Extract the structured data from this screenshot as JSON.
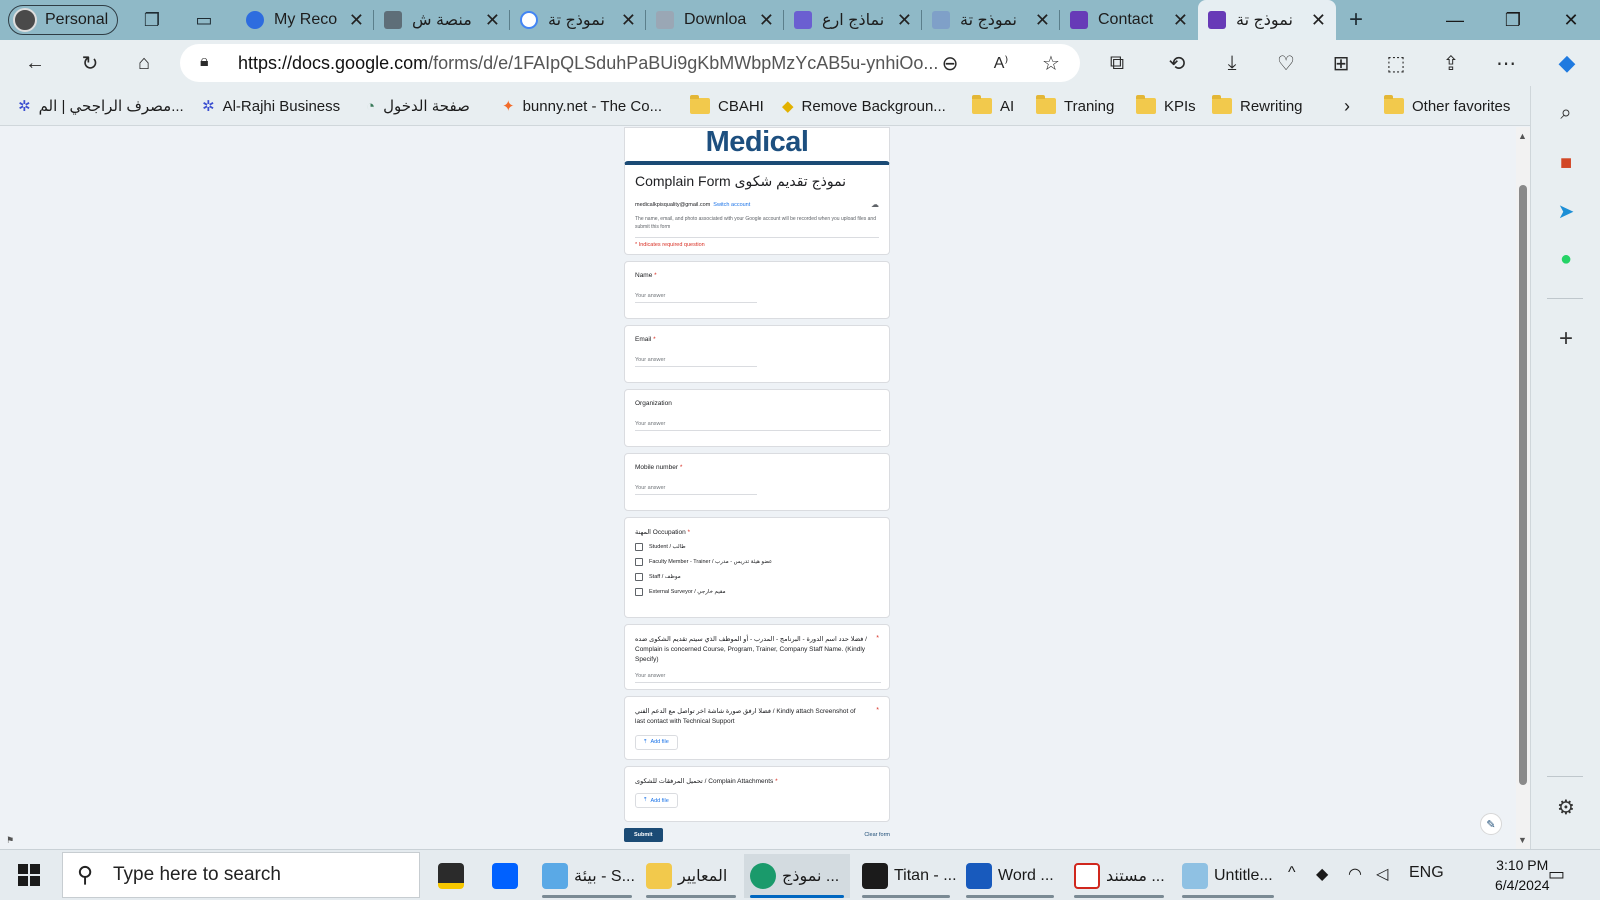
{
  "browser": {
    "profile_label": "Personal",
    "tabs": [
      {
        "title": "My Reco",
        "icon": "zoom-icon"
      },
      {
        "title": "منصة ش",
        "icon": "platform-icon"
      },
      {
        "title": "نموذج تة",
        "icon": "google-icon"
      },
      {
        "title": "Downloa",
        "icon": "download-page-icon"
      },
      {
        "title": "نماذج ارع",
        "icon": "docs-icon"
      },
      {
        "title": "نموذج تة",
        "icon": "app-icon"
      },
      {
        "title": "Contact",
        "icon": "forms-icon"
      },
      {
        "title": "نموذج تة",
        "icon": "forms-icon"
      }
    ],
    "url_host": "https://docs.google.com",
    "url_rest": "/forms/d/e/1FAIpQLSduhPaBUi9gKbMWbpMzYcAB5u-ynhiOo...",
    "bookmarks": [
      {
        "label": "مصرف الراجحي | الم...",
        "icon": "rajhi-icon"
      },
      {
        "label": "Al-Rajhi Business",
        "icon": "rajhi-icon"
      },
      {
        "label": "صفحة الدخول",
        "icon": "login-icon"
      },
      {
        "label": "bunny.net - The Co...",
        "icon": "bunny-icon"
      },
      {
        "label": "CBAHI",
        "icon": "folder-icon"
      },
      {
        "label": "Remove Backgroun...",
        "icon": "removebg-icon"
      },
      {
        "label": "AI",
        "icon": "folder-icon"
      },
      {
        "label": "Traning",
        "icon": "folder-icon"
      },
      {
        "label": "KPIs",
        "icon": "folder-icon"
      },
      {
        "label": "Rewriting",
        "icon": "folder-icon"
      }
    ],
    "other_favorites": "Other favorites"
  },
  "form": {
    "logo": "Medical",
    "title": "Complain Form نموذج تقديم شكوى",
    "account_email": "medicalkpisquality@gmail.com",
    "switch_account": "Switch account",
    "notice": "The name, email, and photo associated with your Google account will be recorded when you upload files and submit this form",
    "required_note": "* Indicates required question",
    "answer_placeholder": "Your answer",
    "questions": {
      "name": "Name",
      "email": "Email",
      "organization": "Organization",
      "mobile": "Mobile number",
      "occupation": "المهنة Occupation",
      "concerned": "فضلا حدد اسم الدورة - البرنامج - المدرب - أو الموظف الذي سيتم تقديم الشكوى ضده / Complain is concerned Course, Program, Trainer, Company Staff Name. (Kindly Specify)",
      "screenshot": "فضلا ارفق صورة شاشة اخر تواصل مع الدعم الفني / Kindly attach Screenshot of last contact with Technical Support",
      "attachments": "تحميل المرفقات للشكوى / Complain Attachments"
    },
    "occupation_options": [
      "Student / طالب",
      "Faculty Member - Trainer / عضو هيئة تدريس - مدرب",
      "Staff / موظف",
      "External Surveyor / مقيم خارجي"
    ],
    "add_file": "Add file",
    "submit": "Submit",
    "clear": "Clear form",
    "required_mark": "*"
  },
  "taskbar": {
    "search_placeholder": "Type here to search",
    "apps": [
      {
        "label": "بيئة - S...",
        "icon": "files-icon"
      },
      {
        "label": "المعايير",
        "icon": "folder-icon"
      },
      {
        "label": "نموذج ...",
        "icon": "edge-icon"
      },
      {
        "label": "Titan - ...",
        "icon": "titan-icon"
      },
      {
        "label": "Word ...",
        "icon": "word-icon"
      },
      {
        "label": "مستند ...",
        "icon": "pdf-icon"
      },
      {
        "label": "Untitle...",
        "icon": "paint-icon"
      }
    ],
    "language": "ENG",
    "time": "3:10 PM",
    "date": "6/4/2024"
  }
}
